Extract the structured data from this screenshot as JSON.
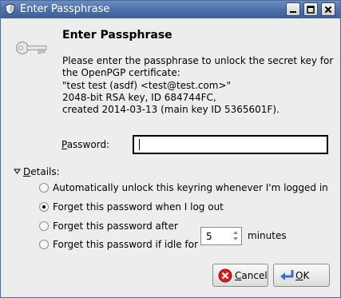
{
  "window": {
    "title": "Enter Passphrase"
  },
  "dialog": {
    "heading": "Enter Passphrase",
    "description_lines": [
      "Please enter the passphrase to unlock the secret key for",
      "the OpenPGP certificate:",
      "\"test test (asdf) <test@test.com>\"",
      "2048-bit RSA key, ID 684744FC,",
      "created 2014-03-13 (main key ID 5365601F)."
    ]
  },
  "password": {
    "label_mnemonic": "P",
    "label_rest": "assword:",
    "value": ""
  },
  "details": {
    "label_mnemonic": "D",
    "label_rest": "etails:",
    "expanded": true,
    "options": [
      {
        "label": "Automatically unlock this keyring whenever I'm logged in",
        "checked": false
      },
      {
        "label": "Forget this password when I log out",
        "checked": true
      },
      {
        "label": "Forget this password after",
        "checked": false
      },
      {
        "label": "Forget this password if idle for",
        "checked": false
      }
    ],
    "idle_minutes_value": "5",
    "idle_minutes_unit": "minutes"
  },
  "buttons": {
    "cancel_mnemonic": "C",
    "cancel_rest": "ancel",
    "ok_mnemonic": "O",
    "ok_rest": "K"
  },
  "icons": {
    "title": "shield-icon",
    "dialog": "key-icon",
    "cancel": "cancel-icon",
    "ok": "enter-arrow-icon"
  },
  "colors": {
    "titlebar": "#4f73ab",
    "cancel_icon": "#d32020",
    "ok_icon": "#3a6fc4"
  }
}
